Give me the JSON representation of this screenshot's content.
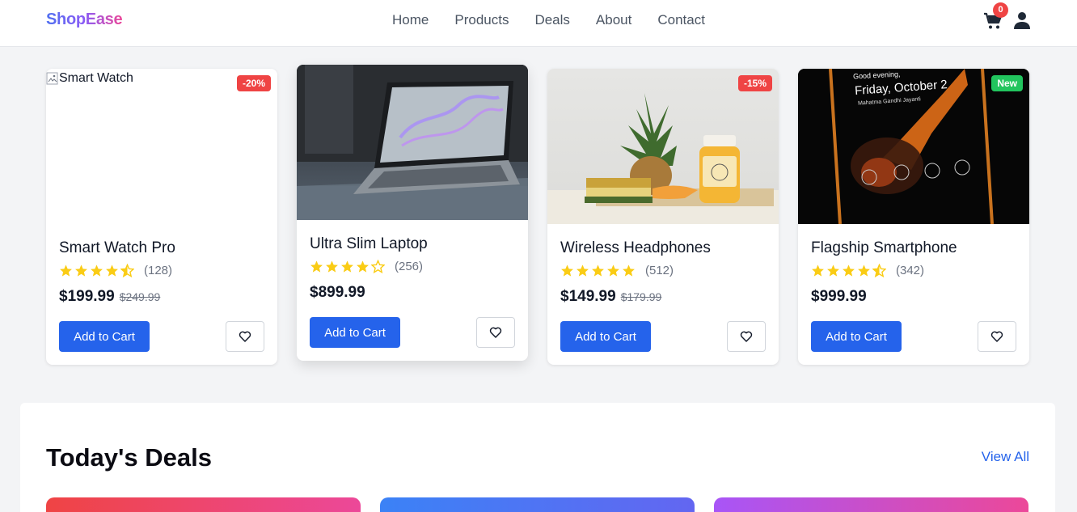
{
  "header": {
    "logo": "ShopEase",
    "nav": [
      "Home",
      "Products",
      "Deals",
      "About",
      "Contact"
    ],
    "cart_count": "0"
  },
  "products": [
    {
      "name": "Smart Watch Pro",
      "rating": 4.5,
      "reviews": "(128)",
      "price": "$199.99",
      "old_price": "$249.99",
      "badge": "-20%",
      "badge_type": "sale",
      "image_alt": "Smart Watch",
      "cta": "Add to Cart"
    },
    {
      "name": "Ultra Slim Laptop",
      "rating": 4,
      "reviews": "(256)",
      "price": "$899.99",
      "old_price": "",
      "badge": "",
      "badge_type": "",
      "cta": "Add to Cart"
    },
    {
      "name": "Wireless Headphones",
      "rating": 5,
      "reviews": "(512)",
      "price": "$149.99",
      "old_price": "$179.99",
      "badge": "-15%",
      "badge_type": "sale",
      "cta": "Add to Cart"
    },
    {
      "name": "Flagship Smartphone",
      "rating": 4.5,
      "reviews": "(342)",
      "price": "$999.99",
      "old_price": "",
      "badge": "New",
      "badge_type": "new",
      "cta": "Add to Cart",
      "screen_text": {
        "greeting": "Good evening,",
        "date": "Friday, October 2",
        "subtitle": "Mahatma Gandhi Jayanti"
      }
    }
  ],
  "deals": {
    "title": "Today's Deals",
    "view_all": "View All",
    "card_colors": [
      [
        "#ef4444",
        "#ec4899"
      ],
      [
        "#3b82f6",
        "#6366f1"
      ],
      [
        "#a855f7",
        "#ec4899"
      ]
    ]
  },
  "colors": {
    "primary": "#2563eb",
    "sale": "#ef4444",
    "new": "#22c55e",
    "star": "#facc15"
  }
}
